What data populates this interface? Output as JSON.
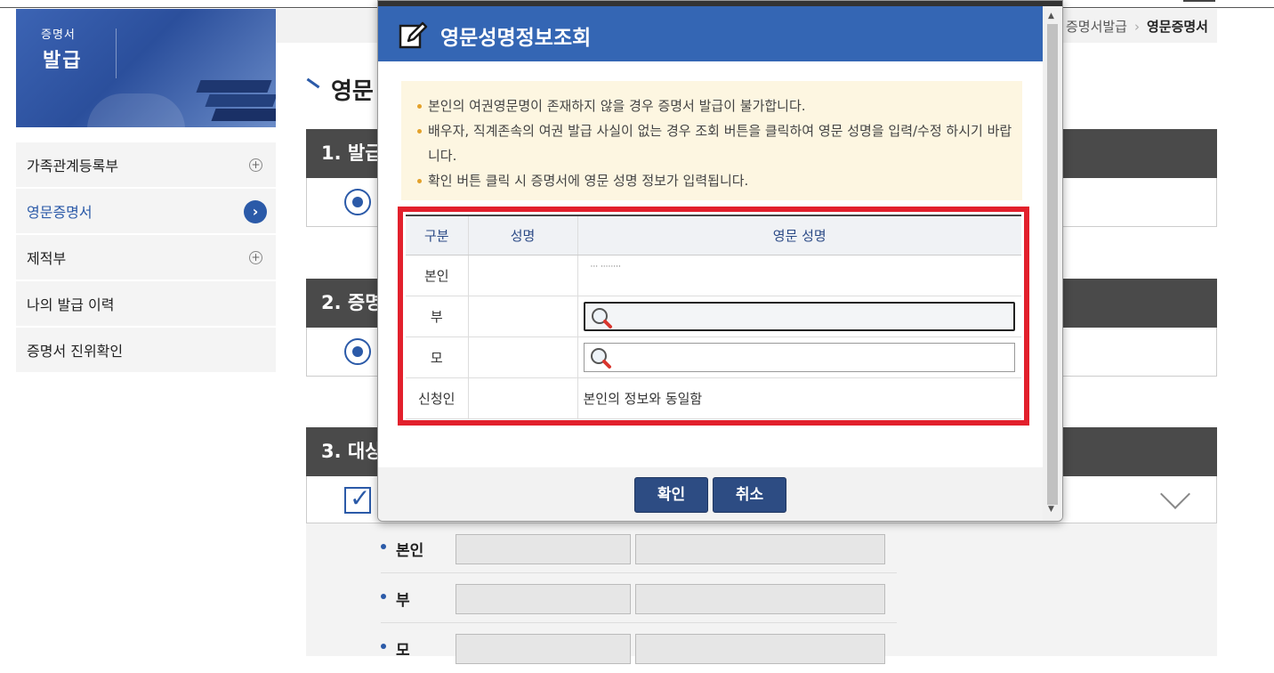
{
  "banner": {
    "line1": "증명서",
    "line2": "발급"
  },
  "sidebar": {
    "items": [
      {
        "label": "가족관계등록부",
        "icon": "plus-circle-icon"
      },
      {
        "label": "영문증명서",
        "icon": "arrow-right-icon",
        "active": true
      },
      {
        "label": "제적부",
        "icon": "plus-circle-icon"
      },
      {
        "label": "나의 발급 이력"
      },
      {
        "label": "증명서 진위확인"
      }
    ]
  },
  "breadcrumb": {
    "parent": "증명서발급",
    "current": "영문증명서"
  },
  "page": {
    "title": "영문"
  },
  "sections": [
    {
      "head": "1. 발급"
    },
    {
      "head": "2. 증명"
    },
    {
      "head": "3. 대상"
    }
  ],
  "form": {
    "rows": [
      {
        "label": "본인"
      },
      {
        "label": "부"
      },
      {
        "label": "모"
      }
    ]
  },
  "popup": {
    "title": "영문성명정보조회",
    "notices": [
      "본인의 여권영문명이 존재하지 않을 경우 증명서 발급이 불가합니다.",
      "배우자, 직계존속의 여권 발급 사실이 없는 경우 조회 버튼을 클릭하여 영문 성명을 입력/수정 하시기 바랍니다.",
      "확인 버튼 클릭 시 증명서에 영문 성명 정보가 입력됩니다."
    ],
    "table": {
      "headers": [
        "구분",
        "성명",
        "영문 성명"
      ],
      "rows": [
        {
          "type": "본인",
          "name": "",
          "eng_name": "··· ········"
        },
        {
          "type": "부",
          "name": "",
          "eng_name": ""
        },
        {
          "type": "모",
          "name": "",
          "eng_name": ""
        },
        {
          "type": "신청인",
          "name": "",
          "eng_name": "본인의 정보와 동일함"
        }
      ]
    },
    "buttons": {
      "confirm": "확인",
      "cancel": "취소"
    }
  },
  "colors": {
    "primary": "#3466b4",
    "highlight_border": "#e2202c",
    "button": "#2d4c83"
  }
}
